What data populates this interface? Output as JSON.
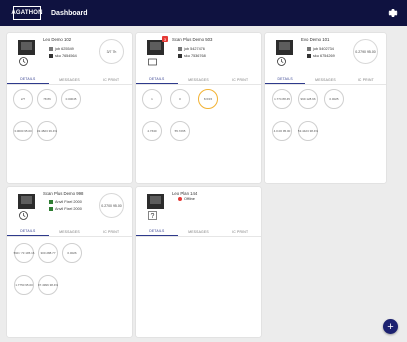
{
  "header": {
    "logo": "AGATHON",
    "title": "Dashboard"
  },
  "tabs_labels": [
    "DETAILS",
    "MESSAGES",
    "IC PRINT"
  ],
  "cards": [
    {
      "name": "Leo Demo 102",
      "job": "job 625549",
      "sku": "sku 7654564",
      "progress": "3/7 7h",
      "metrics": [
        "2/7",
        "78 86",
        "0.00045",
        "3.0000 95.00",
        "32.4823 36.4%"
      ]
    },
    {
      "name": "Scan Plus Demo 503",
      "badge": "3",
      "job": "job 5427476",
      "sku": "sku 7536768",
      "metrics": [
        "1",
        "0",
        "8.6/15",
        "4.7630",
        "55.7265"
      ]
    },
    {
      "name": "Evo Demo 101",
      "job": "job 5402734",
      "sku": "sku 6754269",
      "progress": "0.2790 95.00",
      "metrics": [
        "1.774 88.45",
        "999 128.96",
        "0.0025",
        "4.0.00 95.00",
        "53.4423 38.4%"
      ]
    },
    {
      "name": "Scan Plus Demo 998",
      "row1": "Anvil Fixel 2000",
      "row2": "Anvil Fixel 2000",
      "progress": "0.2700 95.00",
      "metrics": [
        "590 / 73 195.16",
        "300 288.77",
        "0.0026",
        "1.7750 95.00",
        "97.4996 38.4%"
      ]
    },
    {
      "name": "Leo Plan 144",
      "status": "Offline"
    }
  ],
  "fab_label": "+"
}
